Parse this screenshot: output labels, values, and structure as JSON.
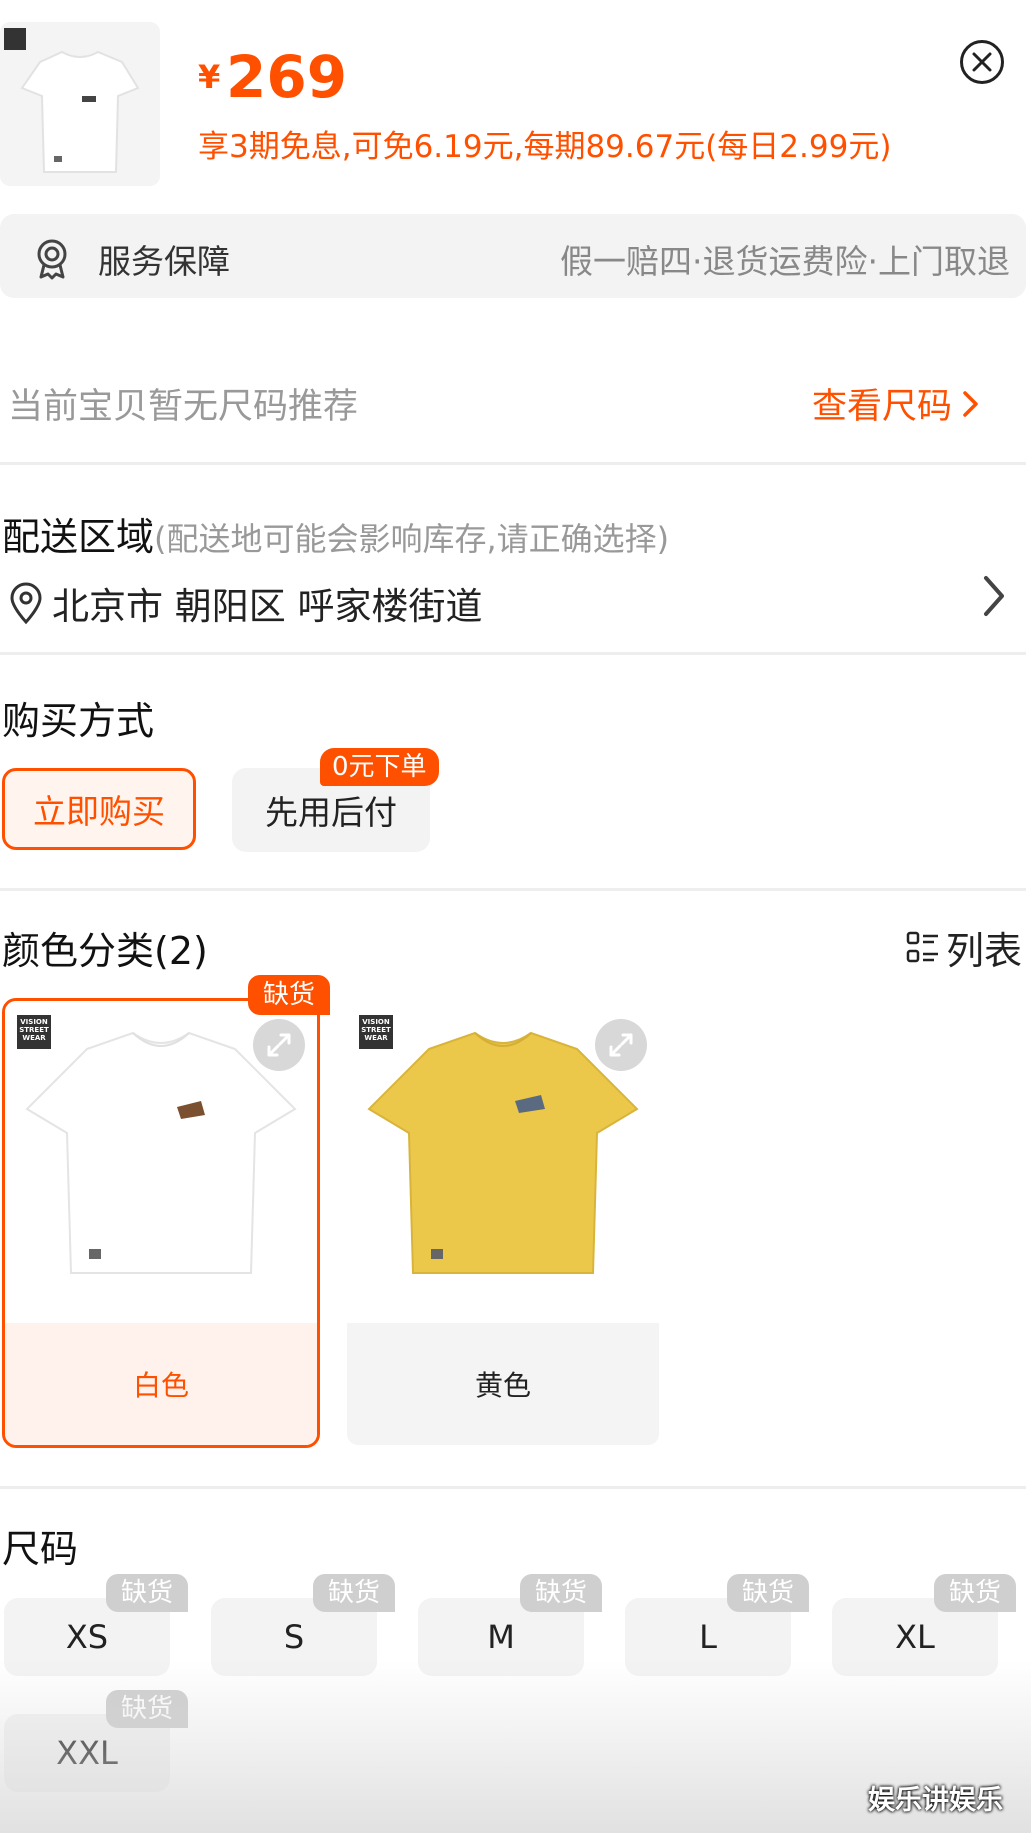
{
  "header": {
    "currency": "¥",
    "price": "269",
    "installment": "享3期免息,可免6.19元,每期89.67元(每日2.99元)"
  },
  "service": {
    "label": "服务保障",
    "value": "假一赔四·退货运费险·上门取退"
  },
  "size_recommend": {
    "text": "当前宝贝暂无尺码推荐",
    "link": "查看尺码"
  },
  "delivery": {
    "title": "配送区域",
    "hint": "(配送地可能会影响库存,请正确选择)",
    "address": "北京市 朝阳区 呼家楼街道"
  },
  "purchase": {
    "title": "购买方式",
    "options": [
      {
        "label": "立即购买",
        "selected": true
      },
      {
        "label": "先用后付",
        "badge": "0元下单"
      }
    ]
  },
  "color": {
    "title": "颜色分类(2)",
    "list_toggle": "列表",
    "options": [
      {
        "name": "白色",
        "selected": true,
        "badge": "缺货",
        "shirt_color": "#ffffff",
        "brand_text": "VISION STREET WEAR"
      },
      {
        "name": "黄色",
        "selected": false,
        "shirt_color": "#ecc84a",
        "brand_text": "VISION STREET WEAR"
      }
    ],
    "accent": "#ff5000"
  },
  "size": {
    "title": "尺码",
    "out_of_stock": "缺货",
    "options": [
      "XS",
      "S",
      "M",
      "L",
      "XL",
      "XXL"
    ]
  },
  "watermark": "娱乐讲娱乐"
}
